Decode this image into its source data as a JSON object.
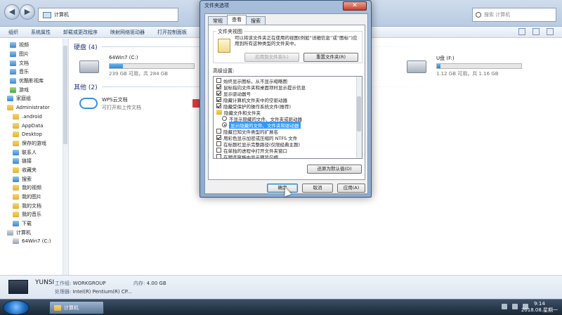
{
  "explorer": {
    "address": "计算机",
    "search_placeholder": "搜索 计算机",
    "toolbar": [
      "组织",
      "系统属性",
      "卸载或更改程序",
      "映射网络驱动器",
      "打开控制面板"
    ],
    "nav": [
      {
        "label": "视频",
        "icon": "video-library-icon"
      },
      {
        "label": "图片",
        "icon": "pictures-library-icon"
      },
      {
        "label": "文档",
        "icon": "documents-library-icon"
      },
      {
        "label": "音乐",
        "icon": "music-library-icon"
      },
      {
        "label": "优酷影视库",
        "icon": "youku-library-icon"
      },
      {
        "label": "游戏",
        "icon": "games-library-icon"
      },
      {
        "label": "家庭组",
        "icon": "homegroup-icon"
      },
      {
        "label": "Administrator",
        "icon": "user-folder-icon"
      },
      {
        "label": ".android",
        "icon": "folder-icon"
      },
      {
        "label": "AppData",
        "icon": "folder-icon"
      },
      {
        "label": "Desktop",
        "icon": "folder-icon"
      },
      {
        "label": "保存的游戏",
        "icon": "folder-icon"
      },
      {
        "label": "联系人",
        "icon": "contacts-folder-icon"
      },
      {
        "label": "链接",
        "icon": "links-folder-icon"
      },
      {
        "label": "收藏夹",
        "icon": "favorites-folder-icon"
      },
      {
        "label": "搜索",
        "icon": "searches-folder-icon"
      },
      {
        "label": "我的视频",
        "icon": "folder-icon"
      },
      {
        "label": "我的图片",
        "icon": "folder-icon"
      },
      {
        "label": "我的文档",
        "icon": "folder-icon"
      },
      {
        "label": "我的音乐",
        "icon": "folder-icon"
      },
      {
        "label": "下载",
        "icon": "downloads-folder-icon"
      },
      {
        "label": "计算机",
        "icon": "computer-icon"
      },
      {
        "label": "64Win7 (C:)",
        "icon": "drive-icon"
      }
    ],
    "hard_disk_header": "硬盘 (4)",
    "drives": [
      {
        "name": "64Win7 (C:)",
        "free": "239 GB 可用，共 284 GB",
        "used_fraction": 0.16
      },
      {
        "name": "U盘 (F:)",
        "free": "1.12 GB 可用，共 1.16 GB",
        "used_fraction": 0.04
      }
    ],
    "other_header": "其他 (2)",
    "wps": {
      "name": "WPS云文档",
      "sub": "可打开和上传文档"
    },
    "details": {
      "host": "YUNSI",
      "workgroup_label": "工作组:",
      "workgroup": "WORKGROUP",
      "memory_label": "内存:",
      "memory": "4.00 GB",
      "cpu_label": "处理器:",
      "cpu": "Intel(R) Pentium(R) CP..."
    }
  },
  "taskbar": {
    "task_label": "计算机",
    "time": "9:14",
    "date": "2018.08.星期一"
  },
  "dialog": {
    "title": "文件夹选项",
    "close": "✕",
    "tabs": [
      "常规",
      "查看",
      "搜索"
    ],
    "folder_views_legend": "文件夹视图",
    "folder_views_desc": "可以将该文件夹正在使用的视图(例如“详细信息”或“图标”)应用到所有这种类型的文件夹中。",
    "apply_to_folders": "应用到文件夹(L)",
    "reset_folders": "重置文件夹(R)",
    "advanced_label": "高级设置:",
    "settings": [
      {
        "type": "check",
        "checked": false,
        "label": "始终显示图标，从不显示缩略图"
      },
      {
        "type": "check",
        "checked": true,
        "label": "鼠标指向文件夹和桌面项时显示提示信息"
      },
      {
        "type": "check",
        "checked": true,
        "label": "显示驱动器号"
      },
      {
        "type": "check",
        "checked": true,
        "label": "隐藏计算机文件夹中的空驱动器"
      },
      {
        "type": "check",
        "checked": true,
        "label": "隐藏受保护的操作系统文件(推荐)"
      },
      {
        "type": "folder",
        "label": "隐藏文件和文件夹"
      },
      {
        "type": "radio",
        "checked": false,
        "label": "不显示隐藏的文件、文件夹或驱动器"
      },
      {
        "type": "radio",
        "checked": true,
        "label": "显示隐藏的文件、文件夹和驱动器",
        "selected": true
      },
      {
        "type": "check",
        "checked": false,
        "label": "隐藏已知文件类型的扩展名"
      },
      {
        "type": "check",
        "checked": true,
        "label": "用彩色显示加密或压缩的 NTFS 文件"
      },
      {
        "type": "check",
        "checked": false,
        "label": "在标题栏显示完整路径(仅限经典主题)"
      },
      {
        "type": "check",
        "checked": false,
        "label": "在单独的进程中打开文件夹窗口"
      },
      {
        "type": "check",
        "checked": false,
        "label": "在预览窗格中显示预览句柄"
      }
    ],
    "restore_defaults": "还原为默认值(D)",
    "ok": "确定",
    "cancel": "取消",
    "apply": "应用(A)"
  }
}
